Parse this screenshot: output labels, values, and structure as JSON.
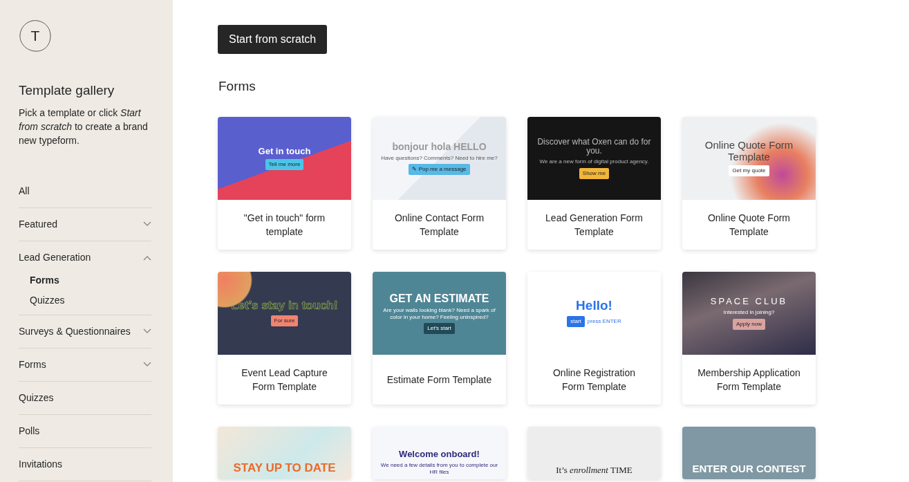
{
  "sidebar": {
    "logo_letter": "T",
    "title": "Template gallery",
    "description": "Pick a template or click *Start from scratch* to create a brand new typeform.",
    "items": [
      {
        "label": "All"
      },
      {
        "label": "Featured",
        "expanded": false
      },
      {
        "label": "Lead Generation",
        "expanded": true,
        "children": [
          {
            "label": "Forms",
            "selected": true
          },
          {
            "label": "Quizzes",
            "selected": false
          }
        ]
      },
      {
        "label": "Surveys & Questionnaires",
        "expanded": false
      },
      {
        "label": "Forms",
        "expanded": false
      },
      {
        "label": "Quizzes"
      },
      {
        "label": "Polls"
      },
      {
        "label": "Invitations"
      }
    ]
  },
  "start_button": "Start from scratch",
  "section_title": "Forms",
  "templates": [
    {
      "kind": "split",
      "title": "\"Get in touch\" form template",
      "headline": "Get in touch",
      "button": "Tell me more"
    },
    {
      "kind": "pale",
      "title": "Online Contact Form Template",
      "headline": "bonjour hola HELLO",
      "sub": "Have questions? Comments? Need to hire me?",
      "button": "✎ Pop me a message"
    },
    {
      "kind": "dark",
      "title": "Lead Generation Form Template",
      "headline": "Discover what Oxen can do for you.",
      "sub": "We are a new form of digital product agency.",
      "button": "Show me"
    },
    {
      "kind": "glow",
      "title": "Online Quote Form Template",
      "headline": "Online Quote Form Template",
      "button": "Get my quote"
    },
    {
      "kind": "navy",
      "title": "Event Lead Capture Form Template",
      "headline": "Let’s stay in touch!",
      "button": "For sure"
    },
    {
      "kind": "teal",
      "title": "Estimate Form Template",
      "headline": "GET AN ESTIMATE",
      "sub": "Are your walls looking blank? Need a spark of color in your home? Feeling uninspired?",
      "button": "Let's start"
    },
    {
      "kind": "white",
      "title": "Online Registration Form Template",
      "headline": "Hello!",
      "button": "start",
      "hint": "press ENTER"
    },
    {
      "kind": "space",
      "title": "Membership Application Form Template",
      "headline": "SPACE CLUB",
      "sub": "Interested in joining?",
      "button": "Apply now"
    },
    {
      "kind": "water",
      "headline": "STAY UP TO DATE"
    },
    {
      "kind": "illus",
      "headline": "Welcome onboard!",
      "sub": "We need a few details from you to complete our HR files"
    },
    {
      "kind": "grey",
      "headline": "It’s *enrollment* TIME"
    },
    {
      "kind": "slate",
      "headline": "ENTER OUR CONTEST"
    }
  ]
}
